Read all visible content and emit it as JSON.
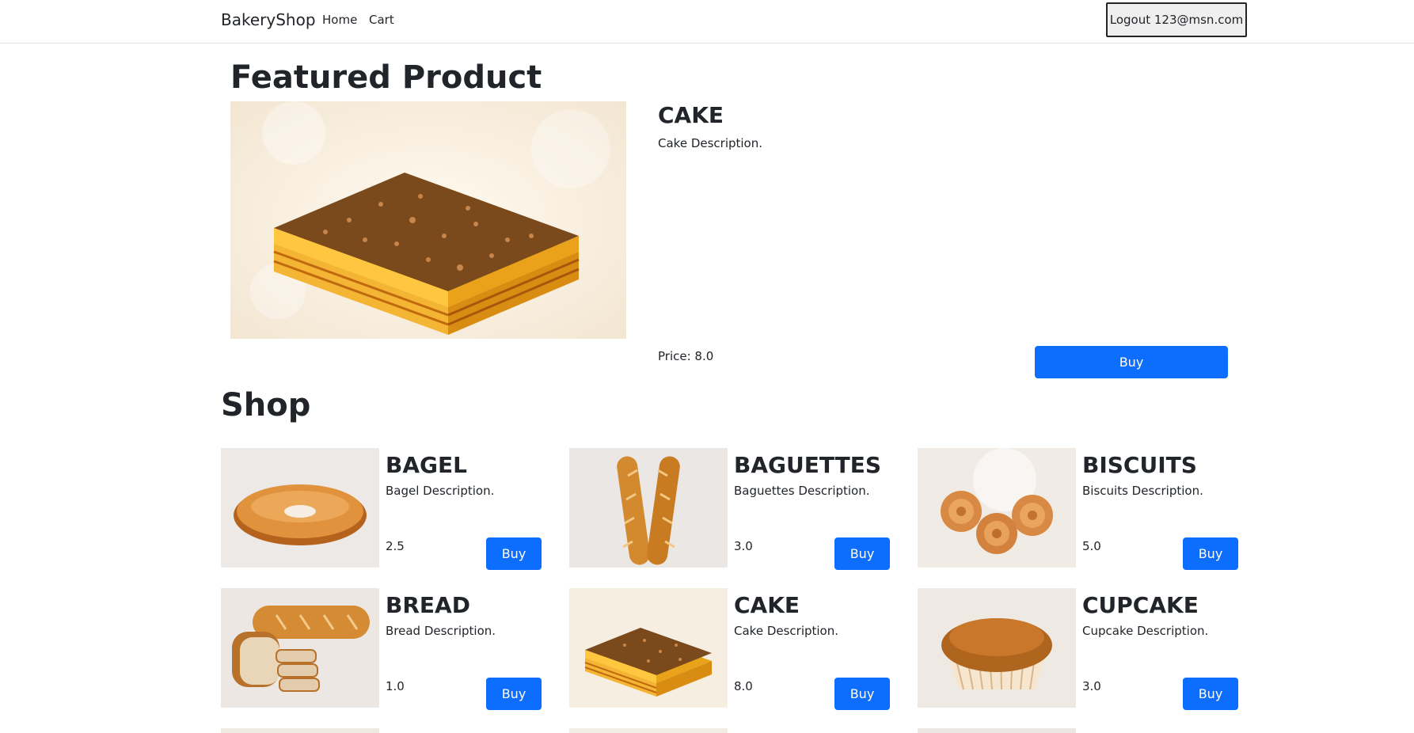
{
  "nav": {
    "brand": "BakeryShop",
    "home": "Home",
    "cart": "Cart",
    "logout": "Logout 123@msn.com"
  },
  "featured": {
    "heading": "Featured Product",
    "name": "CAKE",
    "description": "Cake Description.",
    "price_text": "Price: 8.0",
    "buy": "Buy"
  },
  "shop": {
    "heading": "Shop",
    "items": [
      {
        "name": "BAGEL",
        "description": "Bagel Description.",
        "price": "2.5",
        "buy": "Buy",
        "image": "bagel"
      },
      {
        "name": "BAGUETTES",
        "description": "Baguettes Description.",
        "price": "3.0",
        "buy": "Buy",
        "image": "baguettes"
      },
      {
        "name": "BISCUITS",
        "description": "Biscuits Description.",
        "price": "5.0",
        "buy": "Buy",
        "image": "biscuits"
      },
      {
        "name": "BREAD",
        "description": "Bread Description.",
        "price": "1.0",
        "buy": "Buy",
        "image": "bread"
      },
      {
        "name": "CAKE",
        "description": "Cake Description.",
        "price": "8.0",
        "buy": "Buy",
        "image": "cake"
      },
      {
        "name": "CUPCAKE",
        "description": "Cupcake Description.",
        "price": "3.0",
        "buy": "Buy",
        "image": "cupcake"
      }
    ]
  },
  "colors": {
    "primary": "#0d6efd",
    "text": "#212529",
    "border": "#dee2e6"
  }
}
